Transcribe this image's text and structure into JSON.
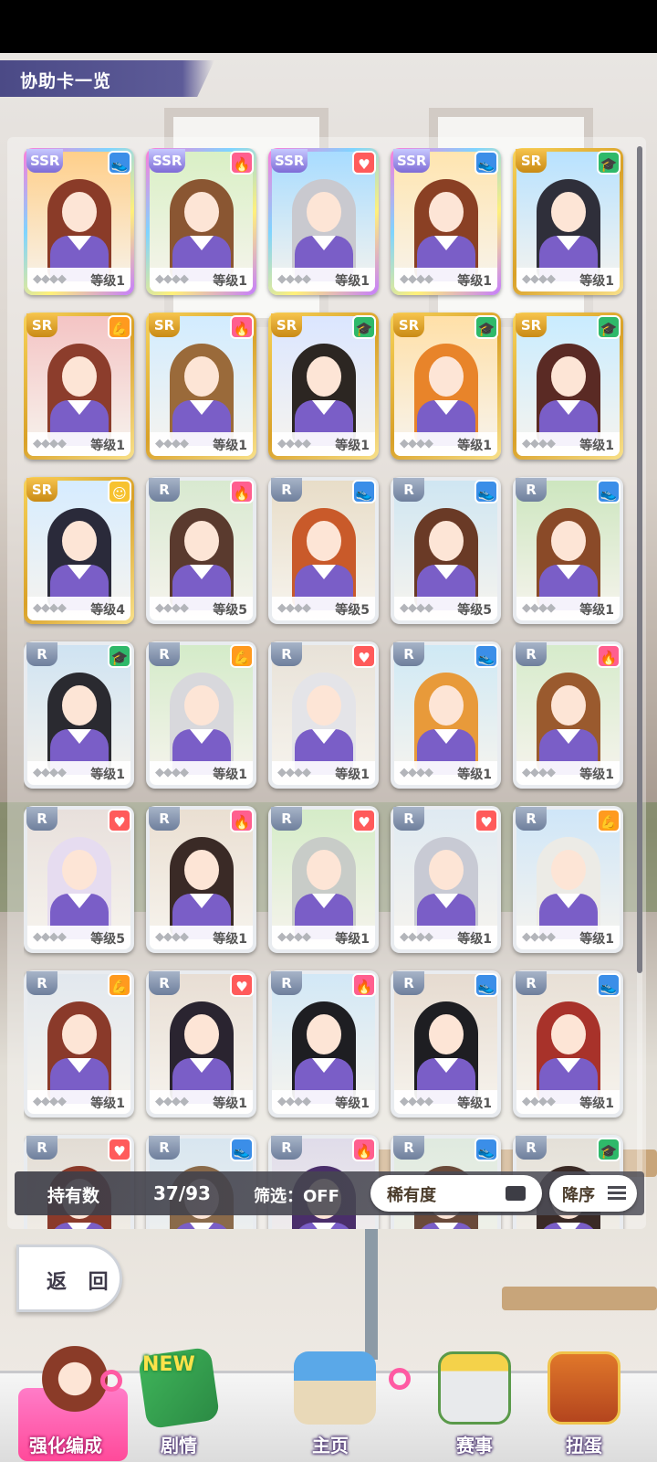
{
  "header": {
    "title": "协助卡一览"
  },
  "cards": [
    {
      "rarity": "SSR",
      "type": "speed",
      "type_icon": "shoe-icon",
      "level": "等级1",
      "palette": [
        "#ffcf8a",
        "#8a3b28"
      ]
    },
    {
      "rarity": "SSR",
      "type": "guts",
      "type_icon": "flame-icon",
      "level": "等级1",
      "palette": [
        "#d9f0c5",
        "#8a5632"
      ]
    },
    {
      "rarity": "SSR",
      "type": "stamina",
      "type_icon": "heart-icon",
      "level": "等级1",
      "palette": [
        "#a8dcff",
        "#c9c9cf"
      ]
    },
    {
      "rarity": "SSR",
      "type": "speed",
      "type_icon": "shoe-icon",
      "level": "等级1",
      "palette": [
        "#ffe5b0",
        "#8a4024"
      ]
    },
    {
      "rarity": "SR",
      "type": "wisdom",
      "type_icon": "mortarboard-icon",
      "level": "等级1",
      "palette": [
        "#b8e2ff",
        "#2f2f3a"
      ]
    },
    {
      "rarity": "SR",
      "type": "power",
      "type_icon": "arm-icon",
      "level": "等级1",
      "palette": [
        "#f4c4c4",
        "#8c3d2c"
      ]
    },
    {
      "rarity": "SR",
      "type": "guts",
      "type_icon": "flame-icon",
      "level": "等级1",
      "palette": [
        "#d2ecff",
        "#9a6a3a"
      ]
    },
    {
      "rarity": "SR",
      "type": "wisdom",
      "type_icon": "mortarboard-icon",
      "level": "等级1",
      "palette": [
        "#dbe6ff",
        "#2c2622"
      ]
    },
    {
      "rarity": "SR",
      "type": "wisdom",
      "type_icon": "mortarboard-icon",
      "level": "等级1",
      "palette": [
        "#ffe0a8",
        "#e8842a"
      ]
    },
    {
      "rarity": "SR",
      "type": "wisdom",
      "type_icon": "mortarboard-icon",
      "level": "等级1",
      "palette": [
        "#c9ecff",
        "#5a2a24"
      ]
    },
    {
      "rarity": "SR",
      "type": "friend",
      "type_icon": "smile-icon",
      "level": "等级4",
      "palette": [
        "#d6ecff",
        "#2a2a3a"
      ]
    },
    {
      "rarity": "R",
      "type": "guts",
      "type_icon": "flame-icon",
      "level": "等级5",
      "palette": [
        "#d8e9d0",
        "#5a3a2e"
      ]
    },
    {
      "rarity": "R",
      "type": "speed",
      "type_icon": "shoe-icon",
      "level": "等级5",
      "palette": [
        "#e8ddc8",
        "#c95a2a"
      ]
    },
    {
      "rarity": "R",
      "type": "speed",
      "type_icon": "shoe-icon",
      "level": "等级5",
      "palette": [
        "#cfe6f2",
        "#6a3a26"
      ]
    },
    {
      "rarity": "R",
      "type": "speed",
      "type_icon": "shoe-icon",
      "level": "等级1",
      "palette": [
        "#cde6bf",
        "#8a4a28"
      ]
    },
    {
      "rarity": "R",
      "type": "wisdom",
      "type_icon": "mortarboard-icon",
      "level": "等级1",
      "palette": [
        "#cfe3f2",
        "#2a2a30"
      ]
    },
    {
      "rarity": "R",
      "type": "power",
      "type_icon": "arm-icon",
      "level": "等级1",
      "palette": [
        "#d4ebc9",
        "#d8d8dc"
      ]
    },
    {
      "rarity": "R",
      "type": "stamina",
      "type_icon": "heart-icon",
      "level": "等级1",
      "palette": [
        "#e8e2d8",
        "#e4e4e8"
      ]
    },
    {
      "rarity": "R",
      "type": "speed",
      "type_icon": "shoe-icon",
      "level": "等级1",
      "palette": [
        "#cfe9f5",
        "#e89a3a"
      ]
    },
    {
      "rarity": "R",
      "type": "guts",
      "type_icon": "flame-icon",
      "level": "等级1",
      "palette": [
        "#d6ebcb",
        "#9a5a2e"
      ]
    },
    {
      "rarity": "R",
      "type": "stamina",
      "type_icon": "heart-icon",
      "level": "等级5",
      "palette": [
        "#e8e0dc",
        "#e6dcf0"
      ]
    },
    {
      "rarity": "R",
      "type": "guts",
      "type_icon": "flame-icon",
      "level": "等级1",
      "palette": [
        "#eadfd2",
        "#3a2a26"
      ]
    },
    {
      "rarity": "R",
      "type": "stamina",
      "type_icon": "heart-icon",
      "level": "等级1",
      "palette": [
        "#d5ecc8",
        "#c8ccc8"
      ]
    },
    {
      "rarity": "R",
      "type": "stamina",
      "type_icon": "heart-icon",
      "level": "等级1",
      "palette": [
        "#dfeaf2",
        "#c8cad4"
      ]
    },
    {
      "rarity": "R",
      "type": "power",
      "type_icon": "arm-icon",
      "level": "等级1",
      "palette": [
        "#cfe6f8",
        "#ecebe6"
      ]
    },
    {
      "rarity": "R",
      "type": "power",
      "type_icon": "arm-icon",
      "level": "等级1",
      "palette": [
        "#e2e8ee",
        "#8a3a2a"
      ]
    },
    {
      "rarity": "R",
      "type": "stamina",
      "type_icon": "heart-icon",
      "level": "等级1",
      "palette": [
        "#e8ded4",
        "#2a2430"
      ]
    },
    {
      "rarity": "R",
      "type": "guts",
      "type_icon": "flame-icon",
      "level": "等级1",
      "palette": [
        "#d2e8f6",
        "#1e1e22"
      ]
    },
    {
      "rarity": "R",
      "type": "speed",
      "type_icon": "shoe-icon",
      "level": "等级1",
      "palette": [
        "#e6dbd0",
        "#1e1e22"
      ]
    },
    {
      "rarity": "R",
      "type": "speed",
      "type_icon": "shoe-icon",
      "level": "等级1",
      "palette": [
        "#e8e0d6",
        "#a8322a"
      ]
    },
    {
      "rarity": "R",
      "type": "stamina",
      "type_icon": "heart-icon",
      "level": "",
      "palette": [
        "#e2dcd4",
        "#8a3a2a"
      ]
    },
    {
      "rarity": "R",
      "type": "speed",
      "type_icon": "shoe-icon",
      "level": "",
      "palette": [
        "#d8e6f0",
        "#8a6a4a"
      ]
    },
    {
      "rarity": "R",
      "type": "guts",
      "type_icon": "flame-icon",
      "level": "",
      "palette": [
        "#e0dcea",
        "#4a2e6a"
      ]
    },
    {
      "rarity": "R",
      "type": "speed",
      "type_icon": "shoe-icon",
      "level": "",
      "palette": [
        "#dfeadf",
        "#6a4a3a"
      ]
    },
    {
      "rarity": "R",
      "type": "wisdom",
      "type_icon": "mortarboard-icon",
      "level": "",
      "palette": [
        "#e4e0d8",
        "#3a2a26"
      ]
    }
  ],
  "stats": {
    "owned_label": "持有数",
    "owned_value": "37/93",
    "filter_label": "筛选：OFF",
    "sort_key_label": "稀有度",
    "sort_order_label": "降序"
  },
  "back_button": {
    "label": "返 回"
  },
  "bottom_nav": {
    "enhance_label": "强化编成",
    "story_label": "剧情",
    "story_badge": "NEW",
    "home_label": "主页",
    "race_label": "赛事",
    "gacha_label": "扭蛋"
  },
  "icons": {
    "shoe-icon": "👟",
    "flame-icon": "🔥",
    "heart-icon": "♥",
    "mortarboard-icon": "🎓",
    "arm-icon": "💪",
    "smile-icon": "☺"
  }
}
